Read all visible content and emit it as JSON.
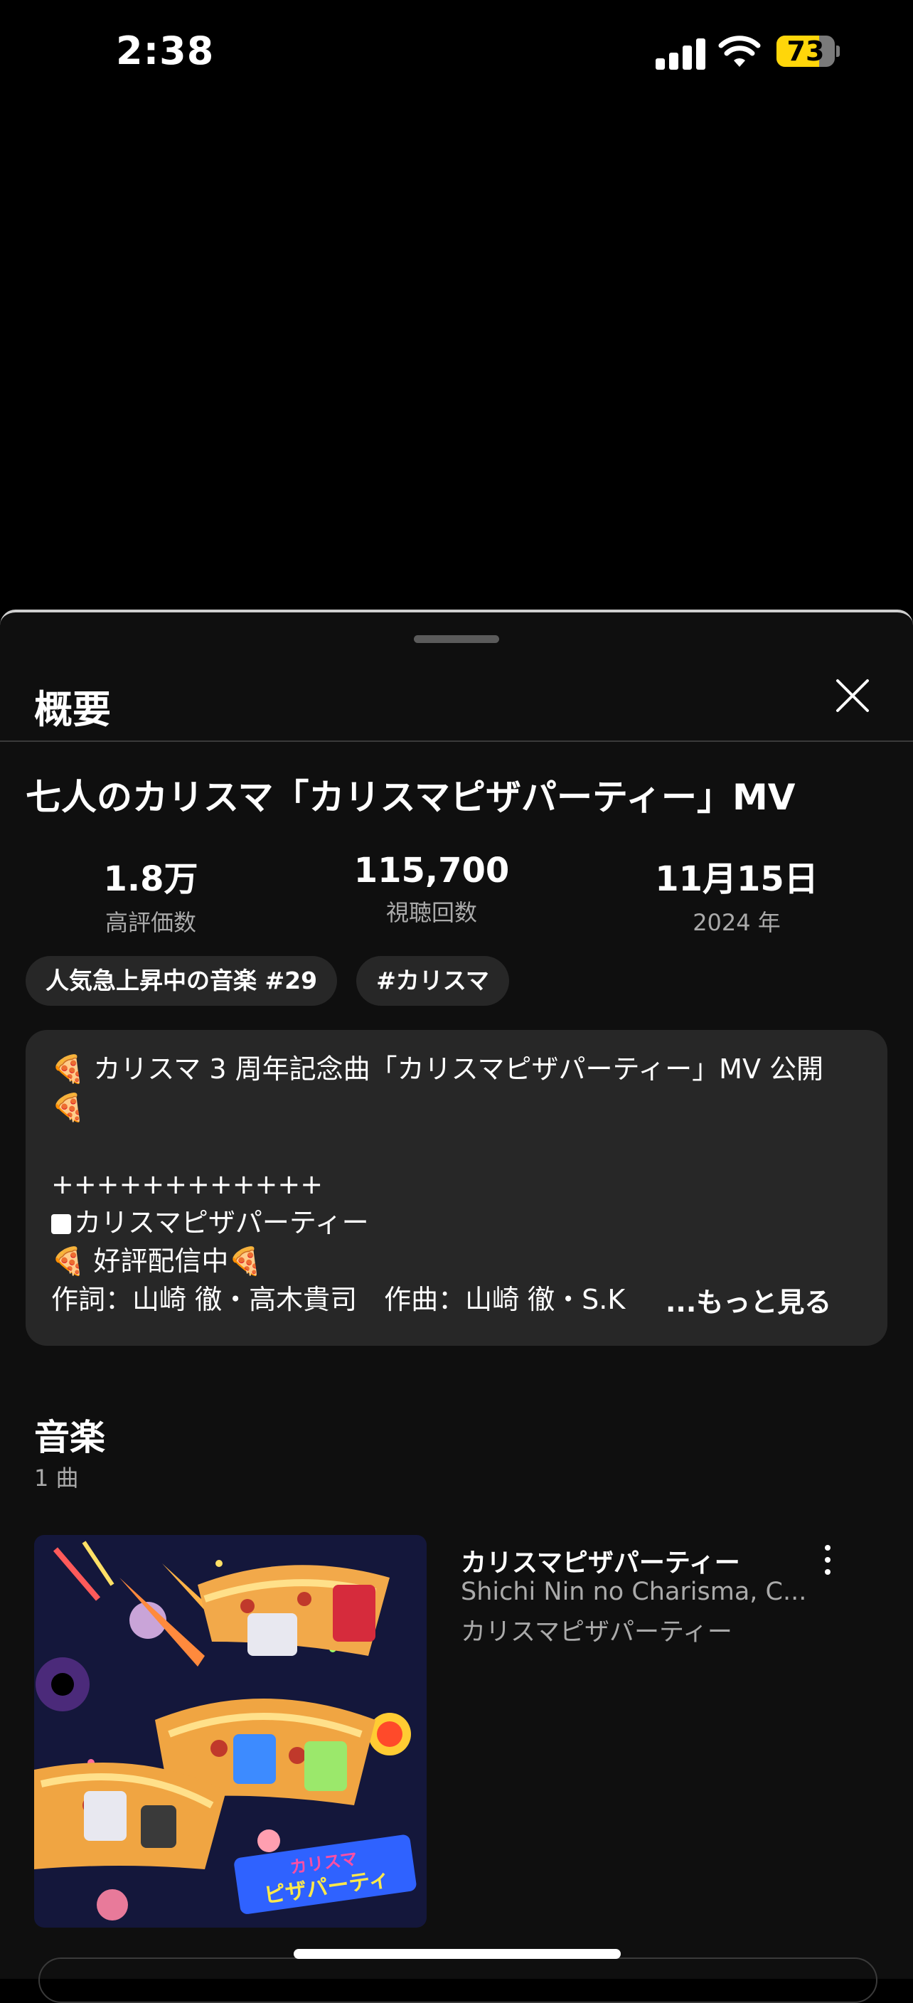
{
  "status_bar": {
    "time": "2:38",
    "battery_level": "73"
  },
  "sheet": {
    "title": "概要",
    "video_title": "七人のカリスマ「カリスマピザパーティー」MV",
    "stats": [
      {
        "value": "1.8万",
        "label": "高評価数"
      },
      {
        "value": "115,700",
        "label": "視聴回数"
      },
      {
        "value": "11月15日",
        "label": "2024 年"
      }
    ],
    "chips": [
      "人気急上昇中の音楽 #29",
      "#カリスマ"
    ],
    "description": {
      "line1": "🍕 カリスマ 3 周年記念曲「カリスマピザパーティー」MV 公開",
      "line2": "🍕",
      "line3": "++++++++++++",
      "line4": "カリスマピザパーティー",
      "line5": "🍕 好評配信中🍕",
      "line6": "作詞：山崎 徹・高木貴司　作曲：山崎 徹・S.K",
      "more": "...もっと見る"
    },
    "music": {
      "heading": "音楽",
      "count": "1 曲",
      "tracks": [
        {
          "title": "カリスマピザパーティー",
          "artist": "Shichi Nin no Charisma, C...",
          "album": "カリスマピザパーティー",
          "art_text": "カリスマ ピザパーティ"
        }
      ]
    }
  },
  "colors": {
    "accent_battery": "#ffd60a",
    "sheet_bg": "#0f0f0f",
    "chip_bg": "#272727"
  }
}
